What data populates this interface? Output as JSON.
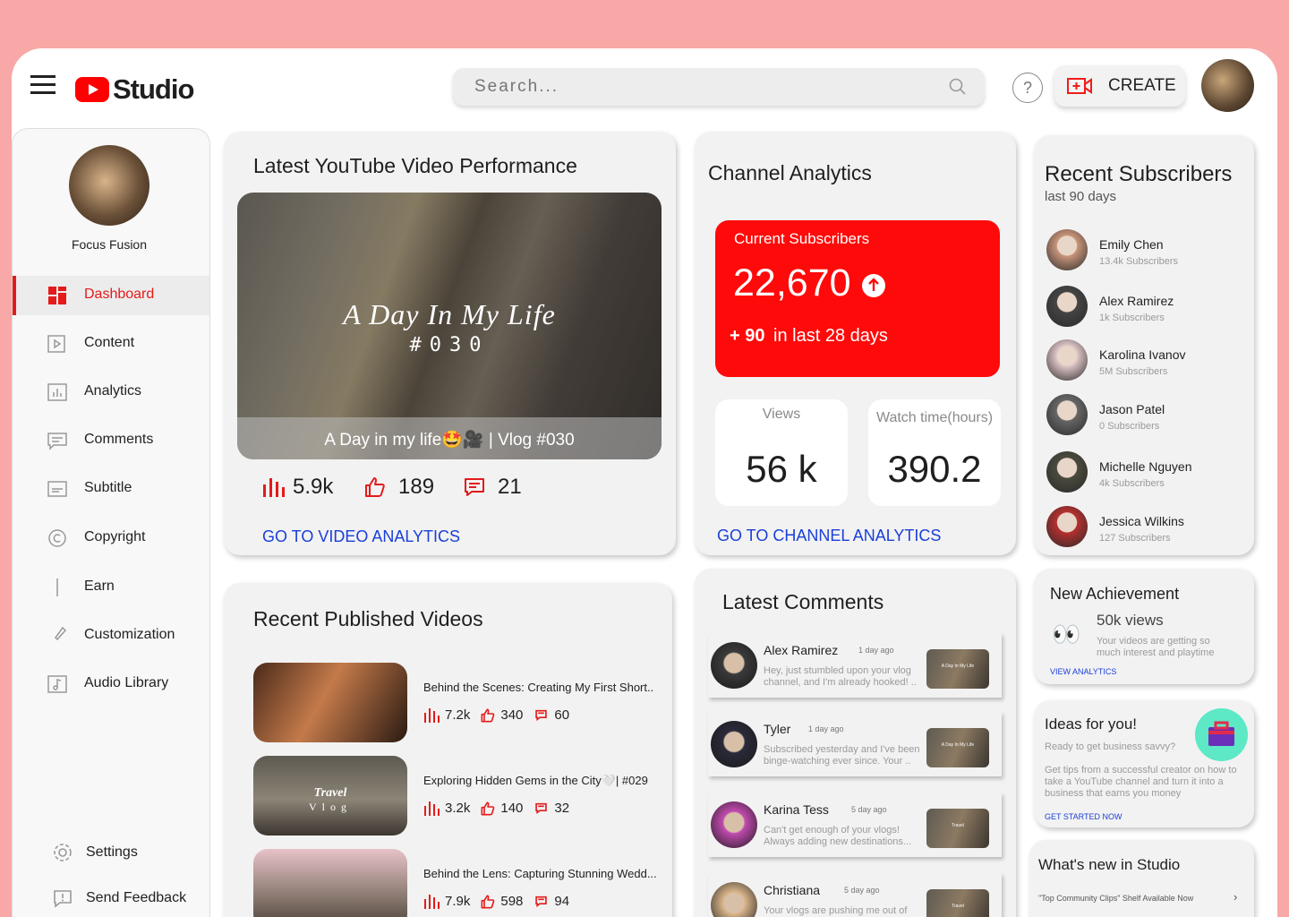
{
  "header": {
    "brand": "Studio",
    "search_placeholder": "Search...",
    "create_label": "CREATE"
  },
  "sidebar": {
    "channel_name": "Focus Fusion",
    "items": [
      {
        "label": "Dashboard",
        "icon": "dashboard-icon",
        "active": true
      },
      {
        "label": "Content",
        "icon": "content-icon"
      },
      {
        "label": "Analytics",
        "icon": "analytics-icon"
      },
      {
        "label": "Comments",
        "icon": "comments-icon"
      },
      {
        "label": "Subtitle",
        "icon": "subtitle-icon"
      },
      {
        "label": "Copyright",
        "icon": "copyright-icon"
      },
      {
        "label": "Earn",
        "icon": "dollar-icon"
      },
      {
        "label": "Customization",
        "icon": "brush-icon"
      },
      {
        "label": "Audio Library",
        "icon": "music-icon"
      }
    ],
    "settings_label": "Settings",
    "feedback_label": "Send Feedback"
  },
  "latest_video": {
    "title": "Latest YouTube Video Performance",
    "thumb_title": "A Day In My Life",
    "thumb_number": "#030",
    "caption": "A Day in my life🤩🎥 | Vlog #030",
    "views": "5.9k",
    "likes": "189",
    "comments": "21",
    "link": "GO TO VIDEO ANALYTICS"
  },
  "channel": {
    "title": "Channel Analytics",
    "current_label": "Current Subscribers",
    "current_value": "22,670",
    "delta_value": "+ 90",
    "delta_label": "in last 28 days",
    "views_label": "Views",
    "views_value": "56 k",
    "watch_label": "Watch time(hours)",
    "watch_value": "390.2",
    "link": "GO TO CHANNEL ANALYTICS"
  },
  "subscribers": {
    "title": "Recent Subscribers",
    "subtitle": "last 90 days",
    "items": [
      {
        "name": "Emily Chen",
        "count": "13.4k Subscribers"
      },
      {
        "name": "Alex Ramirez",
        "count": "1k Subscribers"
      },
      {
        "name": "Karolina Ivanov",
        "count": "5M Subscribers"
      },
      {
        "name": "Jason Patel",
        "count": "0 Subscribers"
      },
      {
        "name": "Michelle Nguyen",
        "count": "4k Subscribers"
      },
      {
        "name": "Jessica Wilkins",
        "count": "127 Subscribers"
      }
    ]
  },
  "recent_videos": {
    "title": "Recent Published Videos",
    "items": [
      {
        "title": "Behind the Scenes: Creating My First Short..",
        "views": "7.2k",
        "likes": "340",
        "comments": "60"
      },
      {
        "title": "Exploring Hidden Gems in the City🤍| #029",
        "views": "3.2k",
        "likes": "140",
        "comments": "32",
        "thumb_text": "Travel",
        "thumb_text2": "Vlog"
      },
      {
        "title": "Behind the Lens: Capturing Stunning Wedd...",
        "views": "7.9k",
        "likes": "598",
        "comments": "94"
      }
    ]
  },
  "comments": {
    "title": "Latest Comments",
    "items": [
      {
        "name": "Alex Ramirez",
        "time": "1 day ago",
        "text": "Hey, just stumbled upon your vlog channel, and I'm already hooked! ..",
        "thumb_text": "A Day In My Life"
      },
      {
        "name": "Tyler",
        "time": "1 day ago",
        "text": "Subscribed yesterday and I've been binge-watching ever since. Your ..",
        "thumb_text": "A Day In My Life"
      },
      {
        "name": "Karina Tess",
        "time": "5 day ago",
        "text": "Can't get enough of your vlogs! Always adding new destinations...",
        "thumb_text": "Travel"
      },
      {
        "name": "Christiana",
        "time": "5 day ago",
        "text": "Your vlogs are pushing me out of",
        "thumb_text": "Travel"
      }
    ]
  },
  "achievement": {
    "title": "New Achievement",
    "value": "50k views",
    "text": "Your videos are getting so much interest and playtime",
    "link": "VIEW ANALYTICS"
  },
  "ideas": {
    "title": "Ideas for you!",
    "subtitle": "Ready to get business savvy?",
    "text": "Get tips from a successful creator on how to take a YouTube channel and turn it into a business that earns you money",
    "link": "GET STARTED NOW"
  },
  "whatsnew": {
    "title": "What's new in Studio",
    "item": "\"Top Community Clips\" Shelf Available Now"
  },
  "colors": {
    "accent": "#ff0000",
    "link": "#1a3fd8",
    "background": "#f8a8a6"
  }
}
